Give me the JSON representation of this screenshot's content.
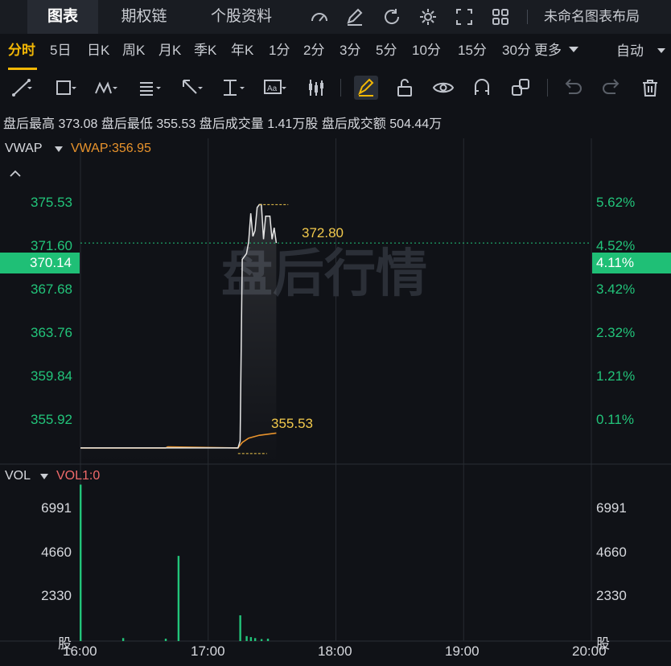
{
  "tabs": [
    {
      "label": "图表",
      "active": true
    },
    {
      "label": "期权链",
      "active": false
    },
    {
      "label": "个股资料",
      "active": false
    }
  ],
  "top_icons": [
    "gauge-icon",
    "edit-icon",
    "refresh-icon",
    "settings-icon",
    "fullscreen-icon",
    "grid-layout-icon"
  ],
  "layout_label": "未命名图表布局",
  "periods": [
    {
      "label": "分时",
      "active": true
    },
    {
      "label": "5日"
    },
    {
      "label": "日K"
    },
    {
      "label": "周K"
    },
    {
      "label": "月K"
    },
    {
      "label": "季K"
    },
    {
      "label": "年K"
    },
    {
      "label": "1分"
    },
    {
      "label": "2分"
    },
    {
      "label": "3分"
    },
    {
      "label": "5分"
    },
    {
      "label": "10分"
    },
    {
      "label": "15分"
    },
    {
      "label": "30分"
    },
    {
      "label": "更多"
    }
  ],
  "auto_label": "自动",
  "info": {
    "high_label": "盘后最高",
    "high_value": "373.08",
    "low_label": "盘后最低",
    "low_value": "355.53",
    "vol_label": "盘后成交量",
    "vol_value": "1.41万股",
    "amt_label": "盘后成交额",
    "amt_value": "504.44万"
  },
  "main_panel": {
    "indicator_name": "VWAP",
    "indicator_value": "VWAP:356.95",
    "watermark": "盘后行情",
    "current_price": "370.14",
    "current_pct": "4.11%",
    "high_marker": "372.80",
    "low_marker": "355.53",
    "y_labels_left": [
      "375.53",
      "371.60",
      "367.68",
      "363.76",
      "359.84",
      "355.92"
    ],
    "y_labels_right": [
      "5.62%",
      "4.52%",
      "3.42%",
      "2.32%",
      "1.21%",
      "0.11%"
    ]
  },
  "vol_panel": {
    "indicator_name": "VOL",
    "indicator_value": "VOL1:0",
    "y_labels": [
      "6991",
      "4660",
      "2330"
    ],
    "unit": "股"
  },
  "colors": {
    "up": "#22c47a",
    "accent": "#f2b705",
    "vwap": "#e8932c",
    "vol_indicator": "#f06a6a",
    "price_line": "#e6e6e6"
  },
  "chart_data": {
    "type": "line",
    "x_ticks": [
      "16:00",
      "17:00",
      "18:00",
      "19:00",
      "20:00"
    ],
    "ylim": [
      354.8,
      377.4
    ],
    "price_series": [
      {
        "t": "16:00",
        "v": 355.92
      },
      {
        "t": "17:14",
        "v": 355.92
      },
      {
        "t": "17:15",
        "v": 356.4
      },
      {
        "t": "17:16",
        "v": 369.0
      },
      {
        "t": "17:18",
        "v": 369.4
      },
      {
        "t": "17:19",
        "v": 370.2
      },
      {
        "t": "17:20",
        "v": 372.2
      },
      {
        "t": "17:21",
        "v": 370.6
      },
      {
        "t": "17:22",
        "v": 371.0
      },
      {
        "t": "17:23",
        "v": 372.6
      },
      {
        "t": "17:24",
        "v": 372.8
      },
      {
        "t": "17:25",
        "v": 372.8
      },
      {
        "t": "17:26",
        "v": 370.4
      },
      {
        "t": "17:27",
        "v": 372.0
      },
      {
        "t": "17:28",
        "v": 372.0
      },
      {
        "t": "17:29",
        "v": 372.0
      },
      {
        "t": "17:30",
        "v": 370.4
      },
      {
        "t": "17:31",
        "v": 371.2
      },
      {
        "t": "17:32",
        "v": 370.14
      }
    ],
    "vwap_series": [
      {
        "t": "16:00",
        "v": 355.92
      },
      {
        "t": "16:40",
        "v": 355.92
      },
      {
        "t": "16:41",
        "v": 356.0
      },
      {
        "t": "17:14",
        "v": 355.92
      },
      {
        "t": "17:16",
        "v": 356.3
      },
      {
        "t": "17:19",
        "v": 356.6
      },
      {
        "t": "17:24",
        "v": 356.8
      },
      {
        "t": "17:32",
        "v": 356.95
      }
    ],
    "volume": {
      "ylim": [
        0,
        8000
      ],
      "bars": [
        {
          "t": "16:00",
          "v": 7900
        },
        {
          "t": "16:20",
          "v": 150
        },
        {
          "t": "16:40",
          "v": 120
        },
        {
          "t": "16:46",
          "v": 4300
        },
        {
          "t": "17:15",
          "v": 1300
        },
        {
          "t": "17:18",
          "v": 250
        },
        {
          "t": "17:20",
          "v": 200
        },
        {
          "t": "17:22",
          "v": 150
        },
        {
          "t": "17:25",
          "v": 100
        },
        {
          "t": "17:28",
          "v": 120
        }
      ]
    }
  }
}
